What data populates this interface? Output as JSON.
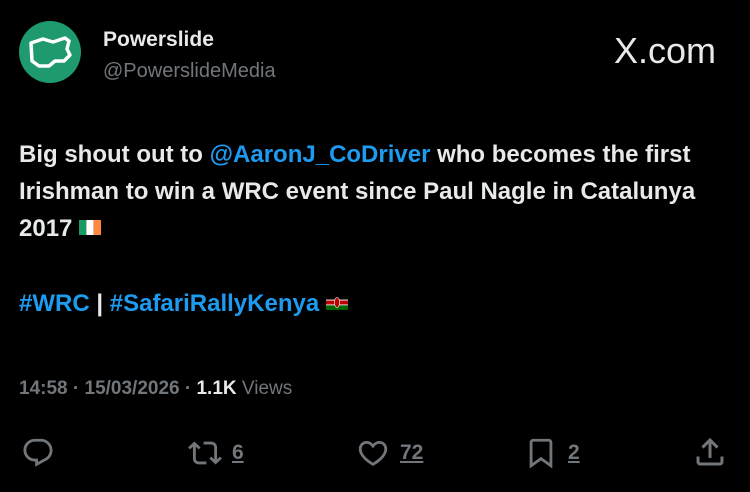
{
  "header": {
    "display_name": "Powerslide",
    "handle": "@PowerslideMedia",
    "source": "X.com",
    "avatar_icon": "powerslide-logo-icon",
    "avatar_color": "#1e9a6e"
  },
  "tweet": {
    "line1_pre": "Big shout out to ",
    "mention": "@AaronJ_CoDriver",
    "line1_post": " who becomes the first Irishman to win a WRC event since Paul Nagle in Catalunya 2017 ",
    "flag1": "ireland-flag-icon",
    "hashtag1": "#WRC",
    "separator": " | ",
    "hashtag2": "#SafariRallyKenya",
    "flag2": "kenya-flag-icon"
  },
  "meta": {
    "time": "14:58",
    "dot1": " · ",
    "date": "15/03/2026",
    "dot2": " · ",
    "views_count": "1.1K",
    "views_label": " Views"
  },
  "actions": {
    "reply_icon": "reply-icon",
    "retweet_icon": "retweet-icon",
    "retweet_count": "6",
    "like_icon": "heart-icon",
    "like_count": "72",
    "bookmark_icon": "bookmark-icon",
    "bookmark_count": "2",
    "share_icon": "share-icon"
  },
  "colors": {
    "background": "#000000",
    "text": "#e7e9ea",
    "secondary": "#71767b",
    "link": "#1d9bf0"
  }
}
